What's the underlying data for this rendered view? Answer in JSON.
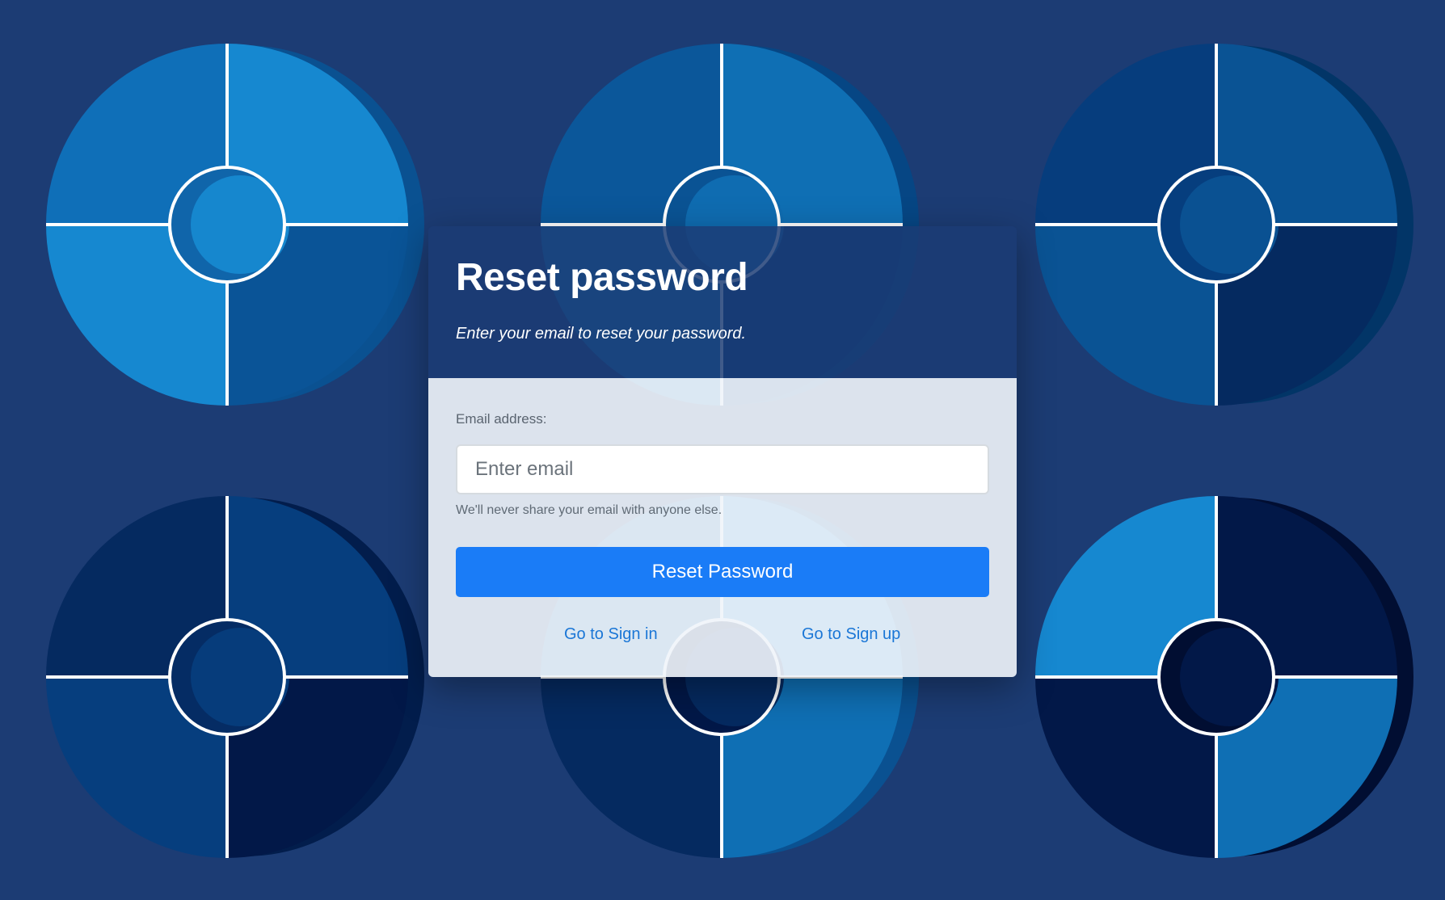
{
  "colors": {
    "page_background": "#1c3c74",
    "button_primary": "#1a7cf7",
    "link": "#1a76d6"
  },
  "card": {
    "title": "Reset password",
    "subtitle": "Enter your email to reset your password.",
    "form": {
      "email_label": "Email address:",
      "email_value": "",
      "email_placeholder": "Enter email",
      "email_help": "We'll never share your email with anyone else.",
      "submit_label": "Reset Password"
    },
    "links": {
      "sign_in": "Go to Sign in",
      "sign_up": "Go to Sign up"
    }
  }
}
